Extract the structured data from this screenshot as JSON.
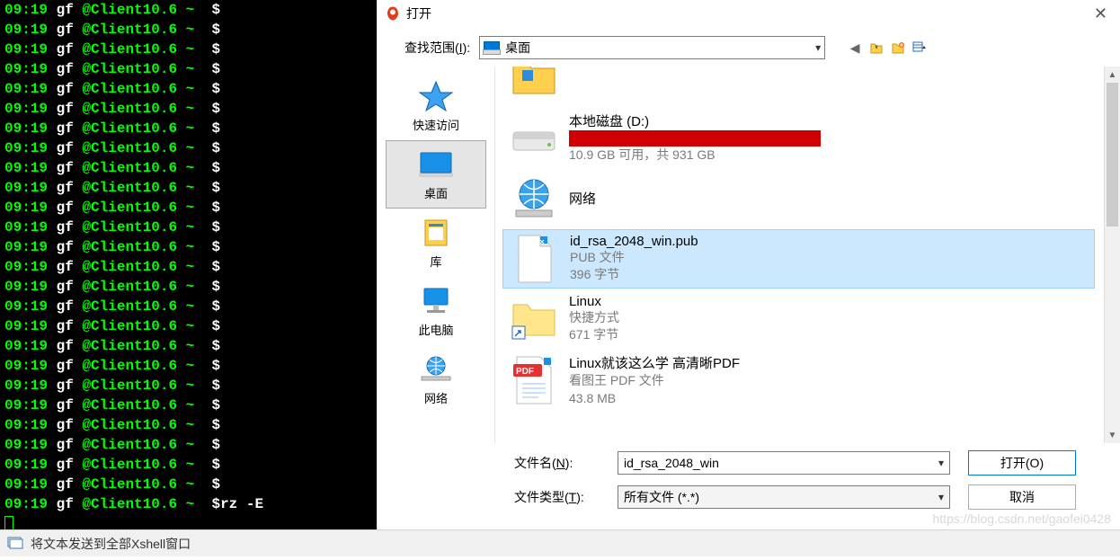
{
  "terminal": {
    "time": "09:19",
    "user": "gf",
    "host": "@Client10.6",
    "path": "~",
    "prompt": "$",
    "command": "rz -E"
  },
  "dialog": {
    "title": "打开",
    "lookup_label_pre": "查找范围(",
    "lookup_label_key": "I",
    "lookup_label_post": "):",
    "lookup_value": "桌面",
    "places": [
      {
        "name": "quick-access",
        "label": "快速访问"
      },
      {
        "name": "desktop",
        "label": "桌面"
      },
      {
        "name": "library",
        "label": "库"
      },
      {
        "name": "this-pc",
        "label": "此电脑"
      },
      {
        "name": "network",
        "label": "网络"
      }
    ],
    "items": {
      "disk_name": "本地磁盘 (D:)",
      "disk_info": "10.9 GB 可用，共 931 GB",
      "network_name": "网络",
      "pub_name": "id_rsa_2048_win.pub",
      "pub_type": "PUB 文件",
      "pub_size": "396 字节",
      "linux_name": "Linux",
      "linux_type": "快捷方式",
      "linux_size": "671 字节",
      "pdf_name": "Linux就该这么学 高清晰PDF",
      "pdf_type": "看图王 PDF 文件",
      "pdf_size": "43.8 MB"
    },
    "filename_label_pre": "文件名(",
    "filename_label_key": "N",
    "filename_label_post": "):",
    "filename_value": "id_rsa_2048_win",
    "filetype_label_pre": "文件类型(",
    "filetype_label_key": "T",
    "filetype_label_post": "):",
    "filetype_value": "所有文件 (*.*)",
    "open_btn": "打开(O)",
    "cancel_btn": "取消"
  },
  "statusbar": {
    "text": "将文本发送到全部Xshell窗口"
  },
  "watermark": "https://blog.csdn.net/gaofei0428"
}
